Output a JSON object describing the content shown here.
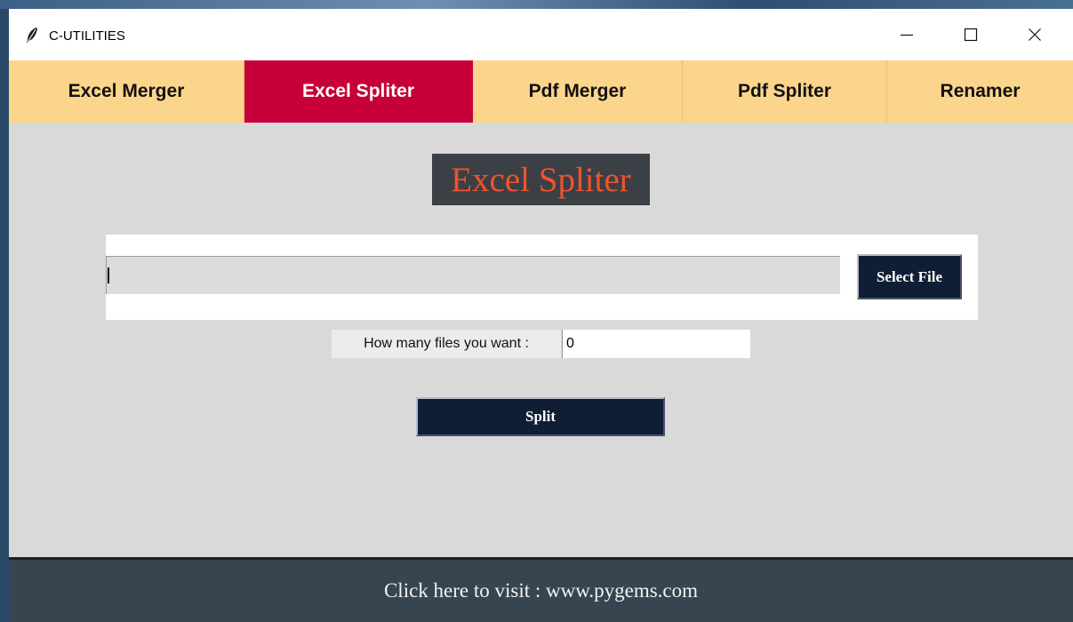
{
  "window": {
    "title": "C-UTILITIES",
    "icon": "feather-icon",
    "controls": [
      "minimize-icon",
      "maximize-icon",
      "close-icon"
    ]
  },
  "tabs": [
    {
      "label": "Excel Merger",
      "active": false
    },
    {
      "label": "Excel Spliter",
      "active": true
    },
    {
      "label": "Pdf Merger",
      "active": false
    },
    {
      "label": "Pdf Spliter",
      "active": false
    },
    {
      "label": "Renamer",
      "active": false
    }
  ],
  "main": {
    "heading": "Excel Spliter",
    "file_input_value": "",
    "select_file_label": "Select File",
    "count_label": "How many files you want  :",
    "count_value": "0",
    "split_label": "Split"
  },
  "footer": {
    "link_text": "Click here to visit : www.pygems.com"
  },
  "colors": {
    "tab_bar": "#fbd58c",
    "tab_active": "#c70039",
    "heading_bg": "#3b3f46",
    "heading_text": "#f0532b",
    "button_bg": "#0f1e35",
    "footer_bg": "#36454f",
    "content_bg": "#d9d9d9"
  }
}
